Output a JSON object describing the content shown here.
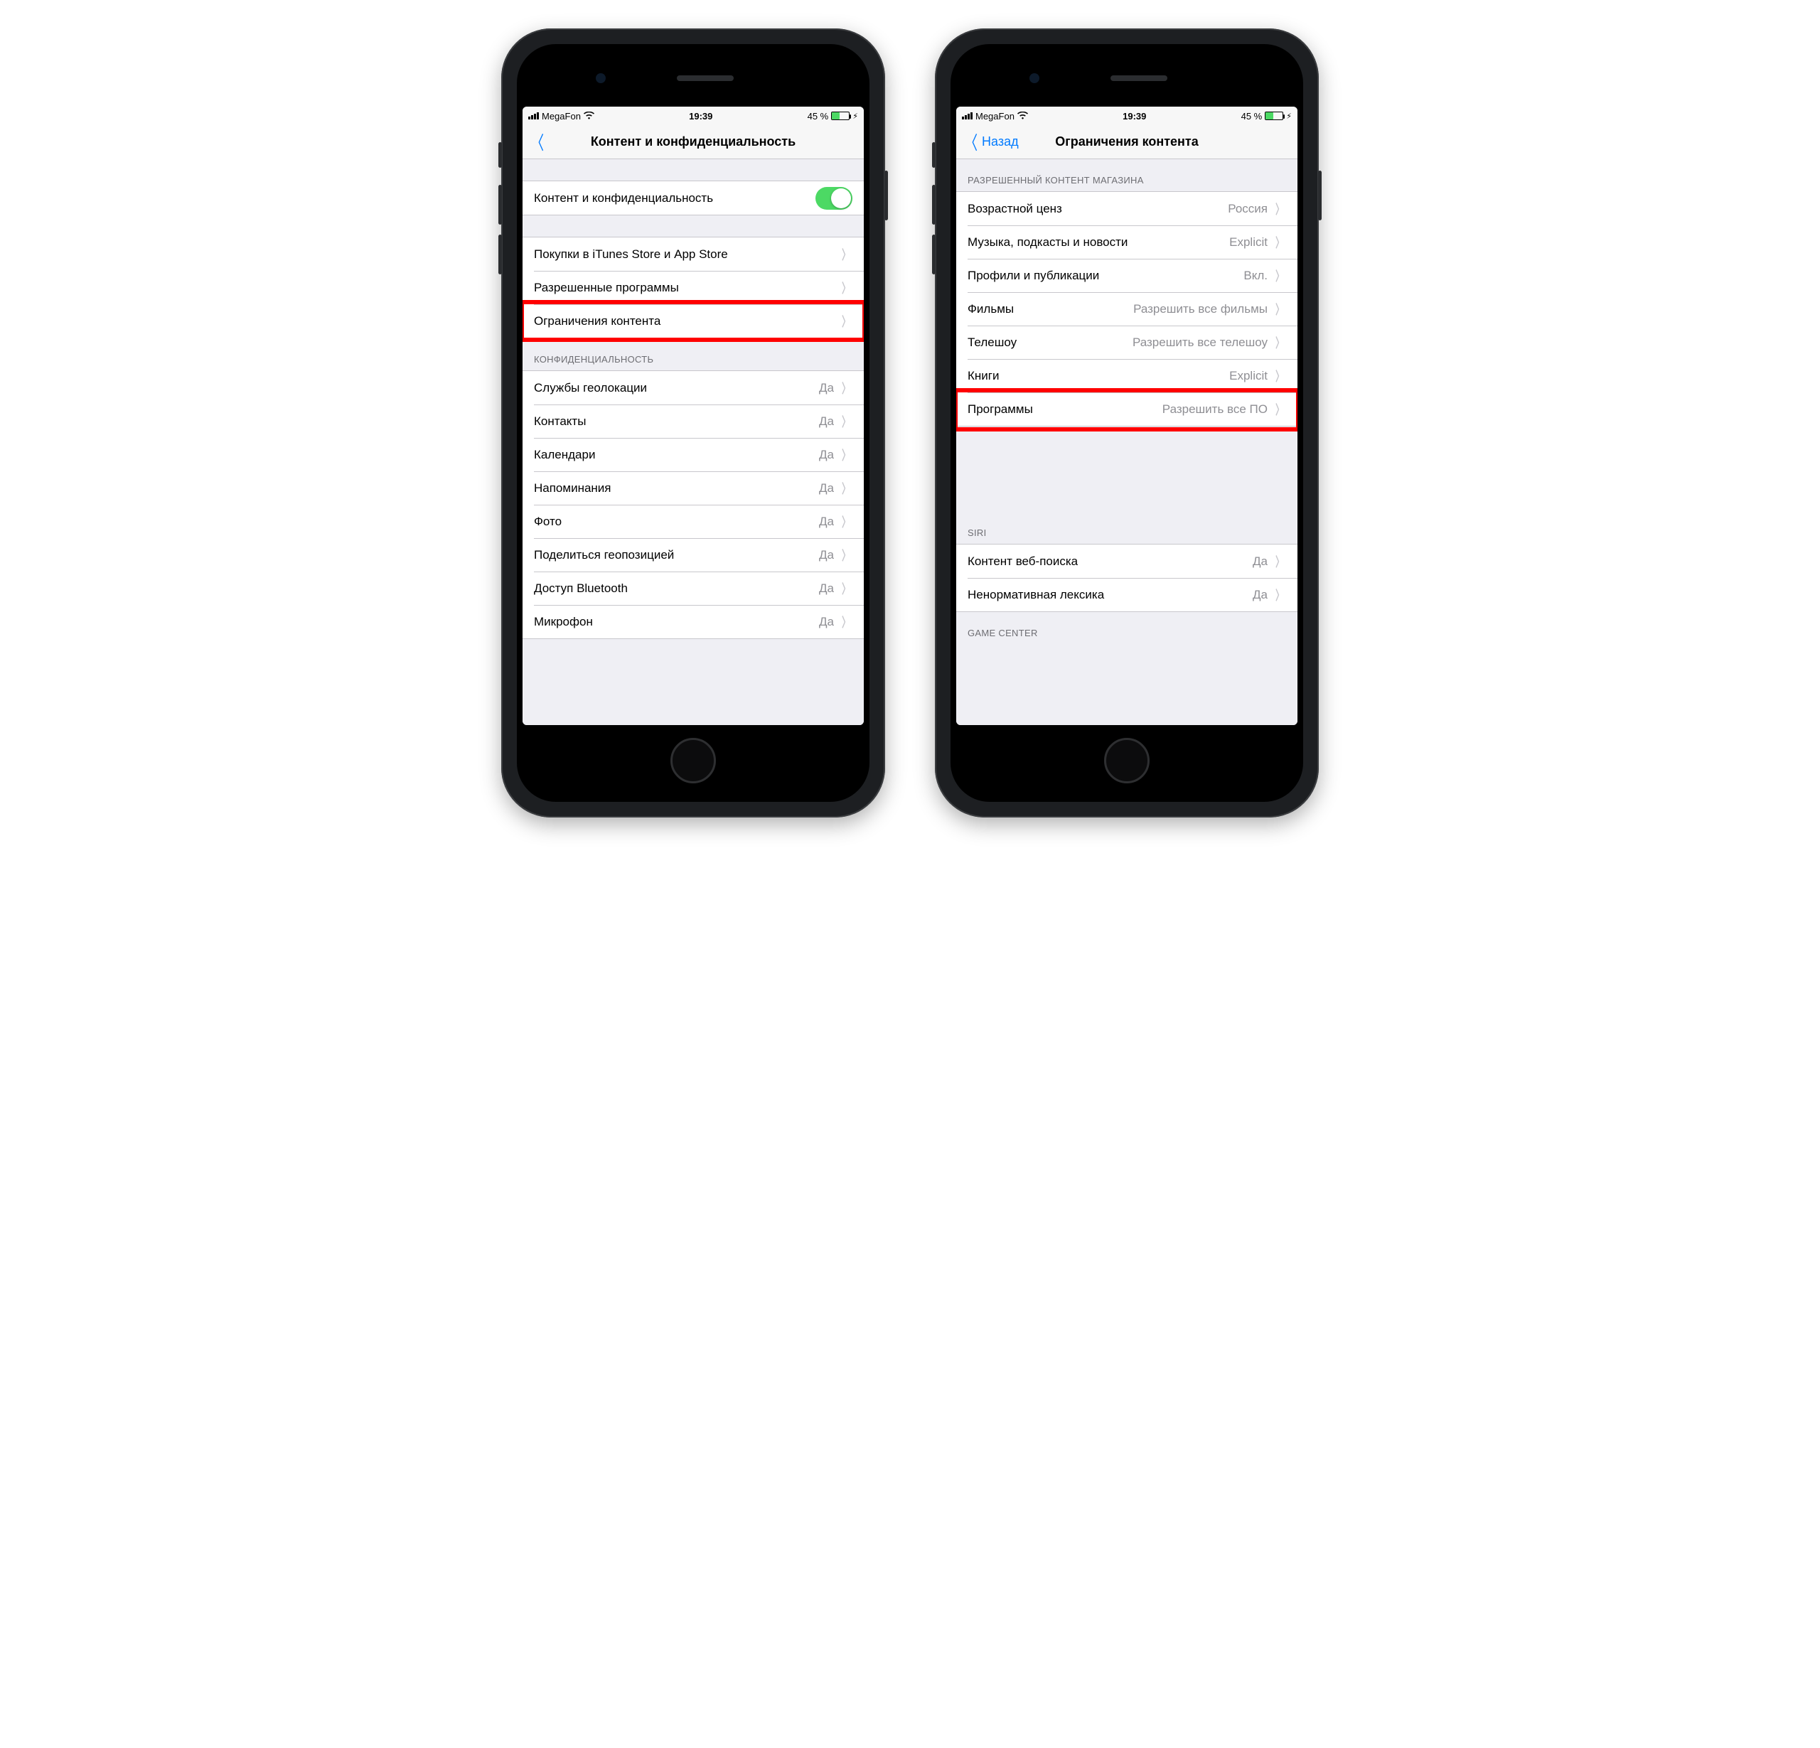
{
  "status": {
    "carrier": "MegaFon",
    "time": "19:39",
    "battery_pct": "45 %"
  },
  "left_phone": {
    "nav_title": "Контент и конфиденциальность",
    "toggle_row": "Контент и конфиденциальность",
    "section2": {
      "purchases": "Покупки в iTunes Store и App Store",
      "allowed_apps": "Разрешенные программы",
      "content_restrictions": "Ограничения контента"
    },
    "privacy_header": "КОНФИДЕНЦИАЛЬНОСТЬ",
    "privacy": {
      "location": "Службы геолокации",
      "contacts": "Контакты",
      "calendars": "Календари",
      "reminders": "Напоминания",
      "photos": "Фото",
      "share_location": "Поделиться геопозицией",
      "bluetooth": "Доступ Bluetooth",
      "microphone": "Микрофон"
    },
    "value_yes": "Да"
  },
  "right_phone": {
    "back_label": "Назад",
    "nav_title": "Ограничения контента",
    "store_header": "РАЗРЕШЕННЫЙ КОНТЕНТ МАГАЗИНА",
    "store": {
      "ratings_label": "Возрастной ценз",
      "ratings_value": "Россия",
      "music_label": "Музыка, подкасты и новости",
      "music_value": "Explicit",
      "profiles_label": "Профили и публикации",
      "profiles_value": "Вкл.",
      "movies_label": "Фильмы",
      "movies_value": "Разрешить все фильмы",
      "tv_label": "Телешоу",
      "tv_value": "Разрешить все телешоу",
      "books_label": "Книги",
      "books_value": "Explicit",
      "apps_label": "Программы",
      "apps_value": "Разрешить все ПО"
    },
    "siri_header": "SIRI",
    "siri": {
      "web_label": "Контент веб-поиска",
      "web_value": "Да",
      "explicit_label": "Ненормативная лексика",
      "explicit_value": "Да"
    },
    "gamecenter_header": "GAME CENTER"
  }
}
